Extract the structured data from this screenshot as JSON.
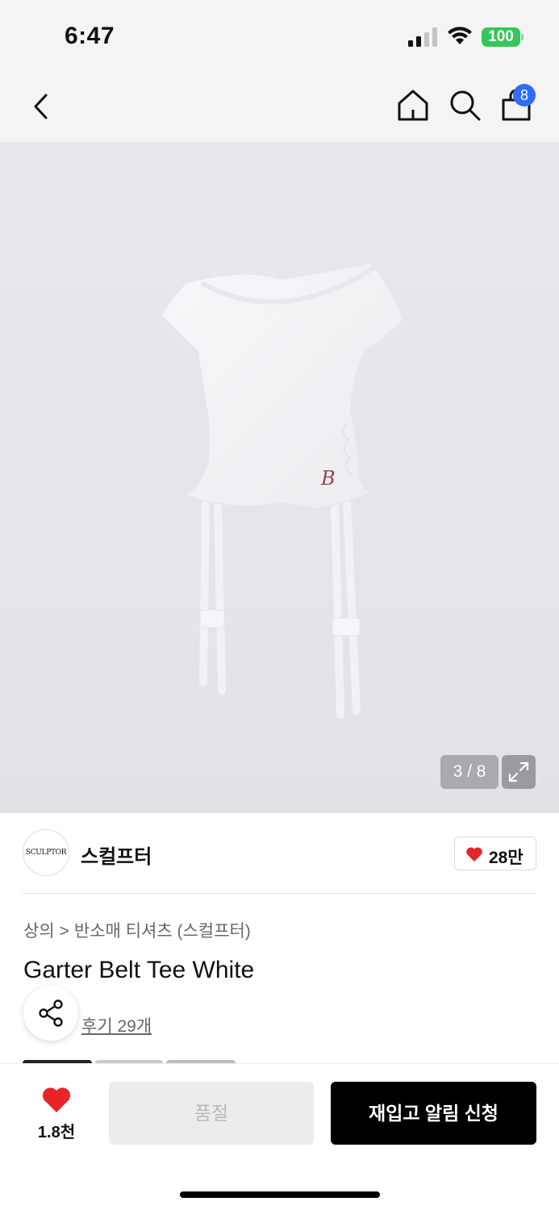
{
  "status_bar": {
    "time": "6:47",
    "battery": "100",
    "battery_color": "#34c759"
  },
  "top_nav": {
    "icons": [
      "back-arrow-icon",
      "home-icon",
      "search-icon",
      "shopping-bag-icon"
    ],
    "bag_count": "8",
    "badge_color": "#2f6df6"
  },
  "gallery": {
    "counter": "3 / 8",
    "image_description_icon": "garter-belt-tee-photo",
    "expand_icon": "expand-icon"
  },
  "brand": {
    "logo_text": "SCULPTOR",
    "name": "스컬프터",
    "like_count": "28만",
    "heart_color": "#e8242a"
  },
  "product": {
    "breadcrumb": [
      "상의",
      "반소매 티셔츠 (스컬프터)"
    ],
    "breadcrumb_separator": ">",
    "title": "Garter Belt Tee White",
    "reviews": "후기 29개"
  },
  "bottom_bar": {
    "wish_count": "1.8천",
    "soldout_label": "품절",
    "restock_label": "재입고 알림 신청"
  }
}
